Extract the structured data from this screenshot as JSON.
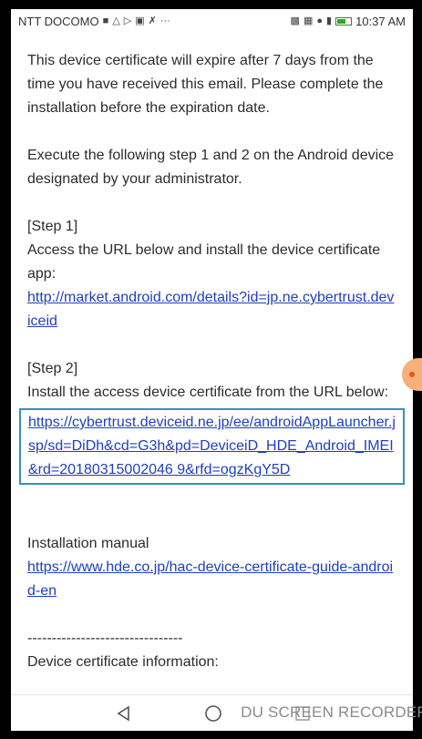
{
  "status_bar": {
    "carrier": "NTT DOCOMO",
    "time": "10:37 AM"
  },
  "email": {
    "intro": "This device certificate will expire after 7 days from the time you have received this email. Please complete the installation before the expiration date.",
    "instruction": "Execute the following step 1 and 2 on the Android device designated by your administrator.",
    "step1_label": "[Step 1]",
    "step1_text": "Access the URL below and install the device certificate app:",
    "step1_link": "http://market.android.com/details?id=jp.ne.cybertrust.deviceid",
    "step2_label": "[Step 2]",
    "step2_text": "Install the access device certificate from the URL below:",
    "step2_link": "https://cybertrust.deviceid.ne.jp/ee/androidAppLauncher.jsp/sd=DiDh&cd=G3h&pd=DeviceiD_HDE_Android_IMEI&rd=20180315002046 9&rfd=ogzKgY5D",
    "manual_label": "Installation manual",
    "manual_link": "https://www.hde.co.jp/hac-device-certificate-guide-android-en",
    "divider": "--------------------------------",
    "cert_info_label": "Device certificate information:"
  },
  "overlay": {
    "recorder_watermark": "DU SCREEN RECORDER"
  }
}
